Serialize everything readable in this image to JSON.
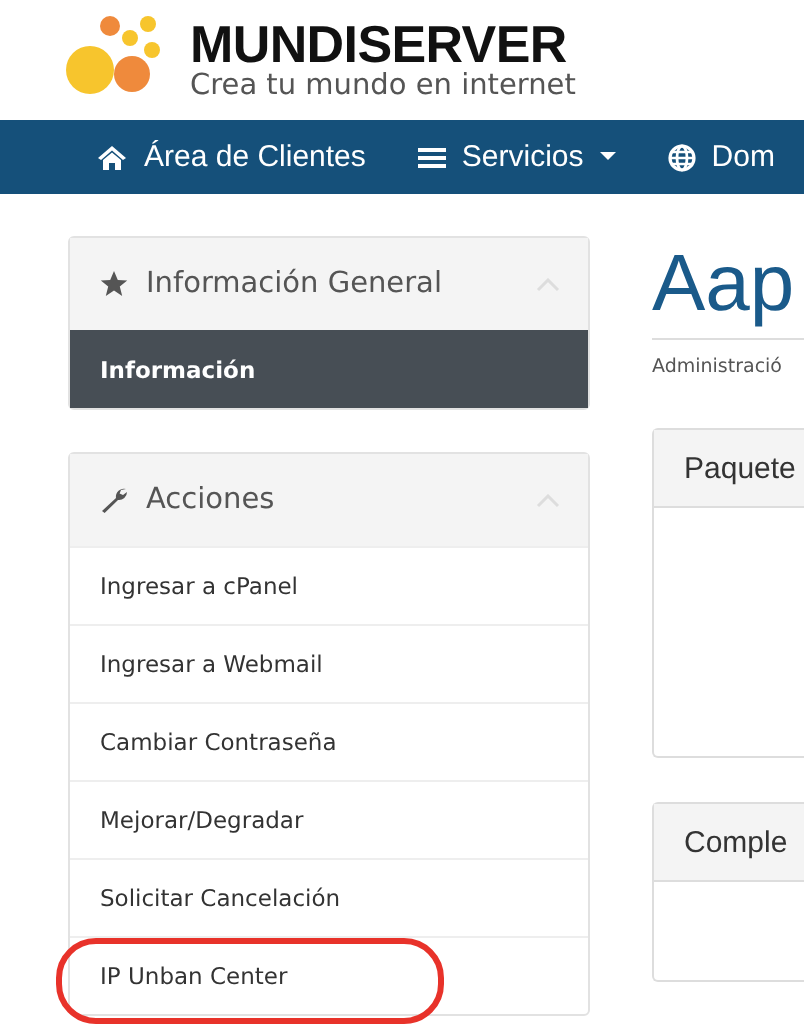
{
  "logo": {
    "name": "MUNDISERVER",
    "tagline": "Crea tu mundo en internet"
  },
  "nav": [
    {
      "label": "Área de Clientes",
      "kind": "home",
      "caret": false
    },
    {
      "label": "Servicios",
      "kind": "menu",
      "caret": true
    },
    {
      "label": "Dom",
      "kind": "globe",
      "caret": false
    }
  ],
  "sidebar": [
    {
      "title": "Información General",
      "kind": "star",
      "collapsed": false,
      "items": [
        {
          "label": "Información",
          "selected": true,
          "highlighted": false
        }
      ]
    },
    {
      "title": "Acciones",
      "kind": "wrench",
      "collapsed": false,
      "items": [
        {
          "label": "Ingresar a cPanel",
          "selected": false,
          "highlighted": false
        },
        {
          "label": "Ingresar a Webmail",
          "selected": false,
          "highlighted": false
        },
        {
          "label": "Cambiar Contraseña",
          "selected": false,
          "highlighted": false
        },
        {
          "label": "Mejorar/Degradar",
          "selected": false,
          "highlighted": false
        },
        {
          "label": "Solicitar Cancelación",
          "selected": false,
          "highlighted": false
        },
        {
          "label": "IP Unban Center",
          "selected": false,
          "highlighted": true
        }
      ]
    }
  ],
  "page": {
    "title": "Aap",
    "breadcrumb": "Administració",
    "panels": [
      {
        "title": "Paquete"
      },
      {
        "title": "Comple"
      }
    ]
  }
}
